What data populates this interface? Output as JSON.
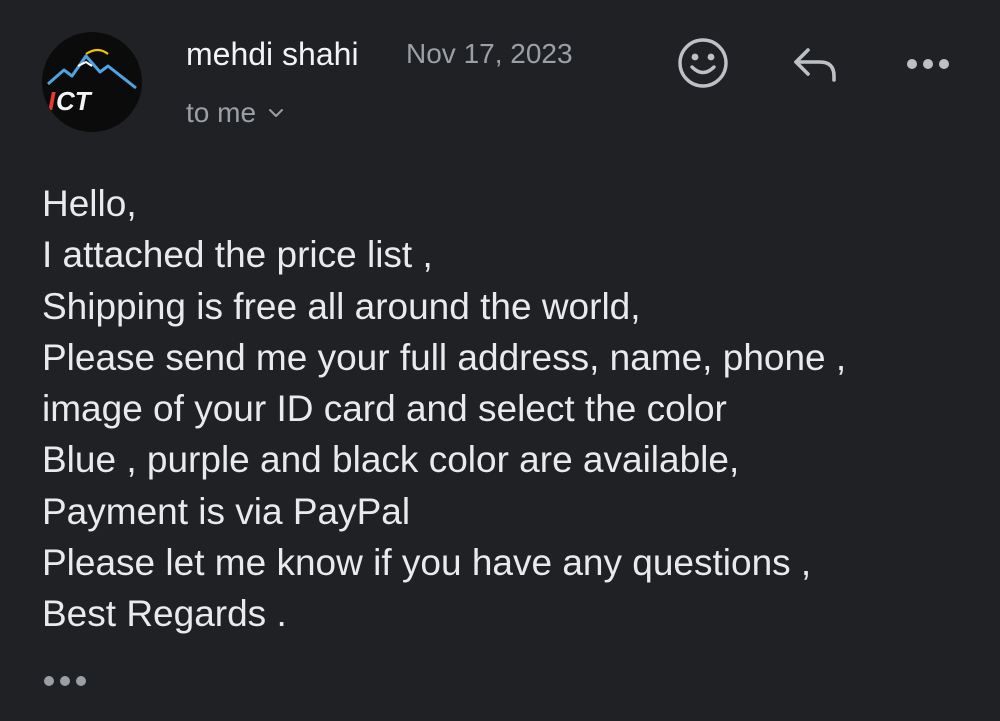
{
  "email": {
    "sender_name": "mehdi shahi",
    "date": "Nov 17, 2023",
    "recipient": "to me",
    "avatar": {
      "logo_text": "ICT",
      "icon": "mountain-logo"
    },
    "actions": {
      "emoji_icon": "smiley-icon",
      "reply_icon": "reply-arrow-icon",
      "more_icon": "more-horizontal-icon"
    },
    "body_lines": [
      "Hello,",
      "I attached the price list ,",
      "Shipping is free all around the world,",
      "Please send me your full address, name, phone ,",
      "image of your ID card and select the color",
      "Blue , purple and black color are available,",
      "Payment is via PayPal",
      "Please let me know if you have any questions ,",
      "Best Regards ."
    ],
    "trimmed_content_icon": "ellipsis-icon"
  },
  "colors": {
    "background": "#202124",
    "text_primary": "#e8eaed",
    "text_secondary": "#9aa0a6",
    "logo_red": "#e53935",
    "logo_green": "#43a047",
    "logo_blue": "#4fa3e0"
  }
}
